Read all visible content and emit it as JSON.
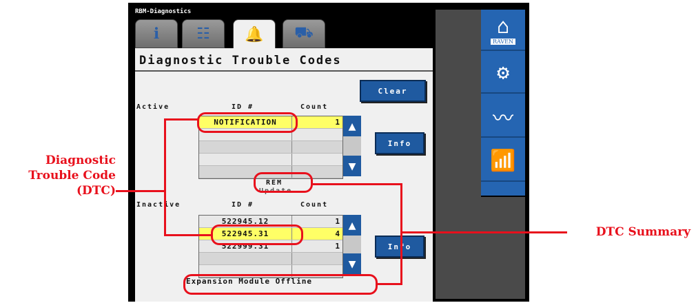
{
  "window": {
    "title": "RBM-Diagnostics"
  },
  "tabs": [
    {
      "icon": "info-icon"
    },
    {
      "icon": "checklist-icon"
    },
    {
      "icon": "alarm-bell-icon",
      "active": true
    },
    {
      "icon": "tractor-icon"
    }
  ],
  "page": {
    "title": "Diagnostic Trouble Codes"
  },
  "buttons": {
    "clear": "Clear",
    "info_active": "Info",
    "info_inactive": "Info"
  },
  "active_table": {
    "section_label": "Active",
    "col_id": "ID #",
    "col_count": "Count",
    "rows": [
      {
        "id": "NOTIFICATION",
        "count": "1",
        "highlighted": true
      },
      {
        "id": "",
        "count": ""
      },
      {
        "id": "",
        "count": ""
      },
      {
        "id": "",
        "count": ""
      },
      {
        "id": "",
        "count": ""
      }
    ]
  },
  "middle": {
    "line1": "REM",
    "line2": "Update"
  },
  "inactive_table": {
    "section_label": "Inactive",
    "col_id": "ID #",
    "col_count": "Count",
    "rows": [
      {
        "id": "522945.12",
        "count": "1"
      },
      {
        "id": "522945.31",
        "count": "4",
        "highlighted": true
      },
      {
        "id": "522999.31",
        "count": "1"
      },
      {
        "id": "",
        "count": ""
      },
      {
        "id": "",
        "count": ""
      }
    ]
  },
  "status": {
    "message": "Expansion Module Offline"
  },
  "rail": [
    {
      "icon": "home-icon",
      "label": "RAVEN"
    },
    {
      "icon": "gears-icon"
    },
    {
      "icon": "diagnostics-pulse-icon"
    },
    {
      "icon": "performance-chart-icon"
    }
  ],
  "callouts": {
    "dtc": [
      "Diagnostic",
      "Trouble Code",
      "(DTC)"
    ],
    "summary": "DTC Summary"
  },
  "colors": {
    "accent": "#1f5aa0",
    "highlight": "#ffff66",
    "callout": "#e8101c"
  }
}
